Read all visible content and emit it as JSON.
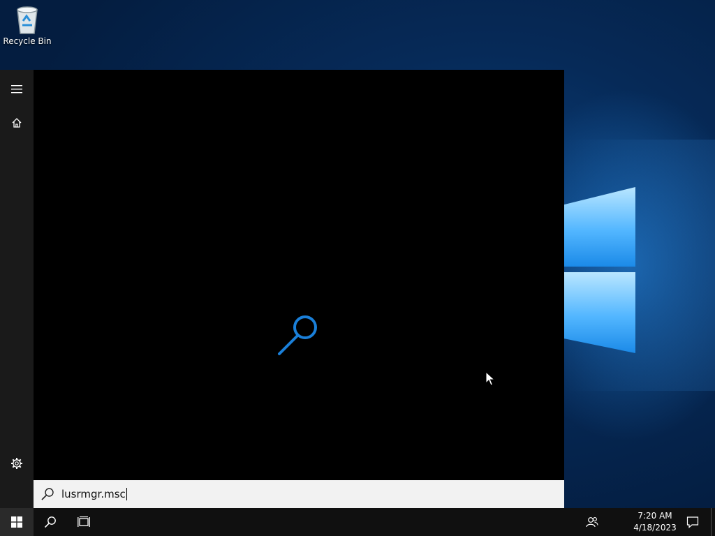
{
  "desktop": {
    "recycle_bin_label": "Recycle Bin"
  },
  "start_menu": {
    "rail": {
      "menu_icon": "hamburger-icon",
      "home_icon": "home-icon",
      "settings_icon": "gear-icon"
    },
    "loading_icon": "search-icon",
    "search": {
      "value": "lusrmgr.msc",
      "icon": "search-icon"
    }
  },
  "taskbar": {
    "start_icon": "windows-logo-icon",
    "search_icon": "search-icon",
    "task_view_icon": "task-view-icon",
    "people_icon": "people-icon",
    "notifications_icon": "action-center-icon",
    "time": "7:20 AM",
    "date": "4/18/2023"
  },
  "colors": {
    "accent": "#1a7fd8",
    "start_bg": "#000000",
    "rail_bg": "#1a1a1a",
    "taskbar_bg": "#101010",
    "searchbox_bg": "#f2f2f2"
  }
}
